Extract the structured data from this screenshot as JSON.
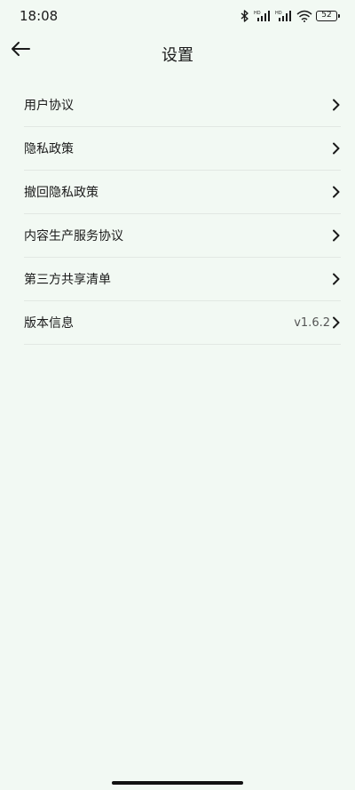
{
  "status_bar": {
    "time": "18:08",
    "battery": "52",
    "icons": [
      "bluetooth-icon",
      "signal-hd-icon",
      "signal-hd-icon",
      "wifi-icon",
      "battery-icon"
    ]
  },
  "header": {
    "title": "设置",
    "back_icon": "arrow-left-icon"
  },
  "menu": {
    "items": [
      {
        "label": "用户协议",
        "value": ""
      },
      {
        "label": "隐私政策",
        "value": ""
      },
      {
        "label": "撤回隐私政策",
        "value": ""
      },
      {
        "label": "内容生产服务协议",
        "value": ""
      },
      {
        "label": "第三方共享清单",
        "value": ""
      },
      {
        "label": "版本信息",
        "value": "v1.6.2"
      }
    ]
  },
  "colors": {
    "background": "#f2f9f3",
    "text": "#1a1a1a",
    "divider": "#e2e8e3"
  }
}
